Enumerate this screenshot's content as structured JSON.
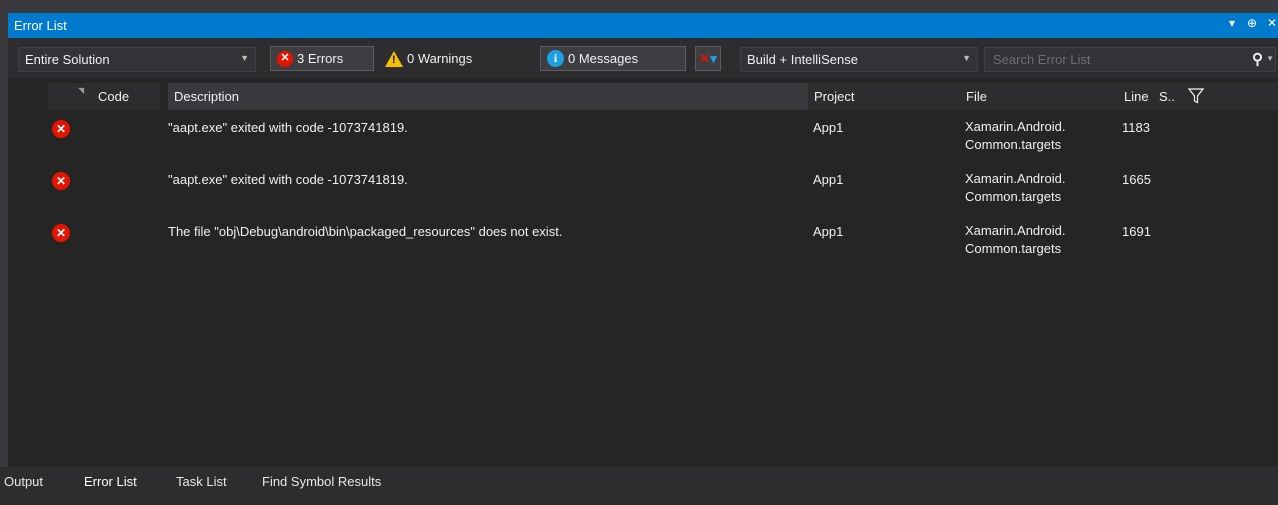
{
  "window": {
    "title": "Error List",
    "controls": [
      "▾",
      "⊕",
      "✕"
    ]
  },
  "toolbar": {
    "scope_value": "Entire Solution",
    "errors_label": "3 Errors",
    "warnings_label": "0 Warnings",
    "messages_label": "0 Messages",
    "build_value": "Build + IntelliSense",
    "search_placeholder": "Search Error List"
  },
  "columns": {
    "code": "Code",
    "description": "Description",
    "project": "Project",
    "file": "File",
    "line": "Line",
    "suppression": "S.."
  },
  "errors": [
    {
      "icon": "error-icon",
      "code": "",
      "description": "\"aapt.exe\" exited with code -1073741819.",
      "project": "App1",
      "file_line1": "Xamarin.Android.",
      "file_line2": "Common.targets",
      "line": "1183"
    },
    {
      "icon": "error-icon",
      "code": "",
      "description": "\"aapt.exe\" exited with code -1073741819.",
      "project": "App1",
      "file_line1": "Xamarin.Android.",
      "file_line2": "Common.targets",
      "line": "1665"
    },
    {
      "icon": "error-icon",
      "code": "",
      "description": "The file \"obj\\Debug\\android\\bin\\packaged_resources\" does not exist.",
      "project": "App1",
      "file_line1": "Xamarin.Android.",
      "file_line2": "Common.targets",
      "line": "1691"
    }
  ],
  "tabs": [
    "Output",
    "Error List",
    "Task List",
    "Find Symbol Results"
  ],
  "colors": {
    "accent": "#007acc",
    "panel_bg": "#252526",
    "error": "#e51400",
    "warning": "#f6c000",
    "info": "#1ba1e2"
  }
}
